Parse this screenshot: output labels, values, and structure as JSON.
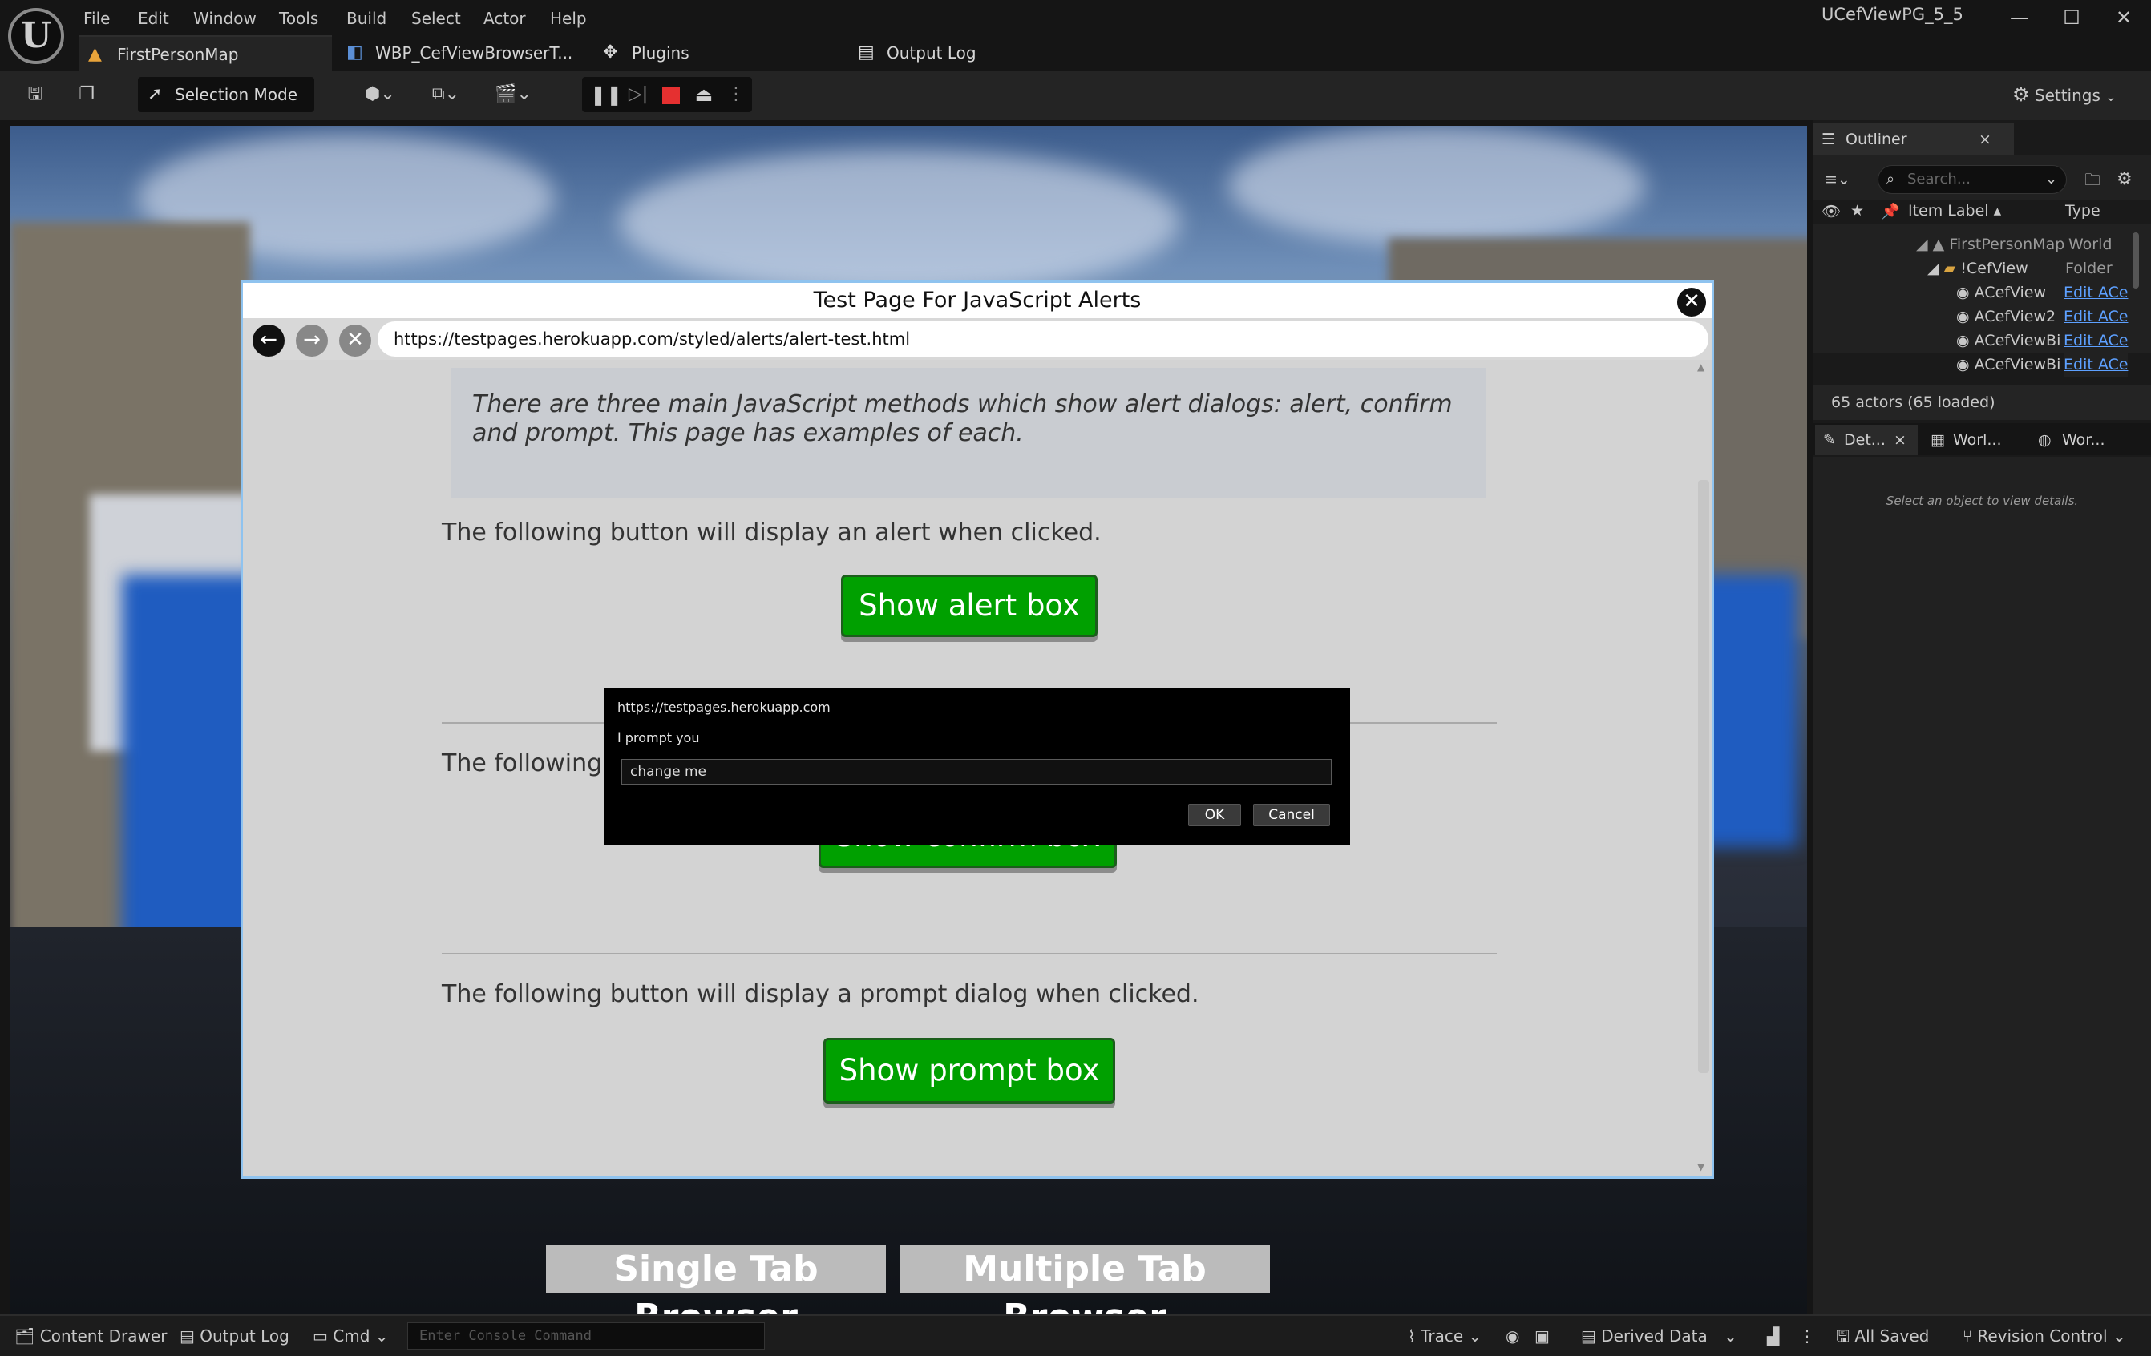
{
  "menubar": {
    "items": [
      "File",
      "Edit",
      "Window",
      "Tools",
      "Build",
      "Select",
      "Actor",
      "Help"
    ]
  },
  "app_title": "UCefViewPG_5_5",
  "window_controls": {
    "minimize": "—",
    "maximize": "☐",
    "close": "✕"
  },
  "doc_tabs": [
    {
      "label": "FirstPersonMap",
      "icon": "level-icon",
      "active": true
    },
    {
      "label": "WBP_CefViewBrowserT...",
      "icon": "widget-blueprint-icon",
      "active": false
    },
    {
      "label": "Plugins",
      "icon": "plugin-icon",
      "active": false
    },
    {
      "label": "Output Log",
      "icon": "log-icon",
      "active": false
    }
  ],
  "toolbar": {
    "selection_mode": "Selection Mode",
    "settings": "Settings"
  },
  "browser": {
    "title": "Test Page For JavaScript Alerts",
    "url": "https://testpages.herokuapp.com/styled/alerts/alert-test.html",
    "intro": "There are three main JavaScript methods which show alert dialogs: alert, confirm and prompt. This page has examples of each.",
    "alert_text": "The following button will display an alert when clicked.",
    "alert_button": "Show alert box",
    "confirm_text": "The following b",
    "confirm_button": "Show confirm box",
    "prompt_text": "The following button will display a prompt dialog when clicked.",
    "prompt_button": "Show prompt box"
  },
  "dialog": {
    "origin": "https://testpages.herokuapp.com",
    "message": "I prompt you",
    "input_value": "change me",
    "ok": "OK",
    "cancel": "Cancel"
  },
  "viewport_buttons": {
    "single": "Single Tab Browser",
    "multiple": "Multiple Tab Browser"
  },
  "outliner": {
    "tab": "Outliner",
    "search_placeholder": "Search...",
    "col_label": "Item Label",
    "col_type": "Type",
    "rows": [
      {
        "label": "FirstPersonMap",
        "type": "World"
      },
      {
        "label": "!CefView",
        "type": "Folder"
      },
      {
        "label": "ACefView",
        "type": "Edit ACe"
      },
      {
        "label": "ACefView2",
        "type": "Edit ACe"
      },
      {
        "label": "ACefViewBi",
        "type": "Edit ACe"
      },
      {
        "label": "ACefViewBi",
        "type": "Edit ACe"
      }
    ],
    "count": "65 actors (65 loaded)"
  },
  "details": {
    "tabs": [
      "Det...",
      "Worl...",
      "Wor..."
    ],
    "empty": "Select an object to view details."
  },
  "statusbar": {
    "content_drawer": "Content Drawer",
    "output_log": "Output Log",
    "cmd": "Cmd",
    "console_placeholder": "Enter Console Command",
    "trace": "Trace",
    "derived_data": "Derived Data",
    "all_saved": "All Saved",
    "revision_control": "Revision Control"
  }
}
